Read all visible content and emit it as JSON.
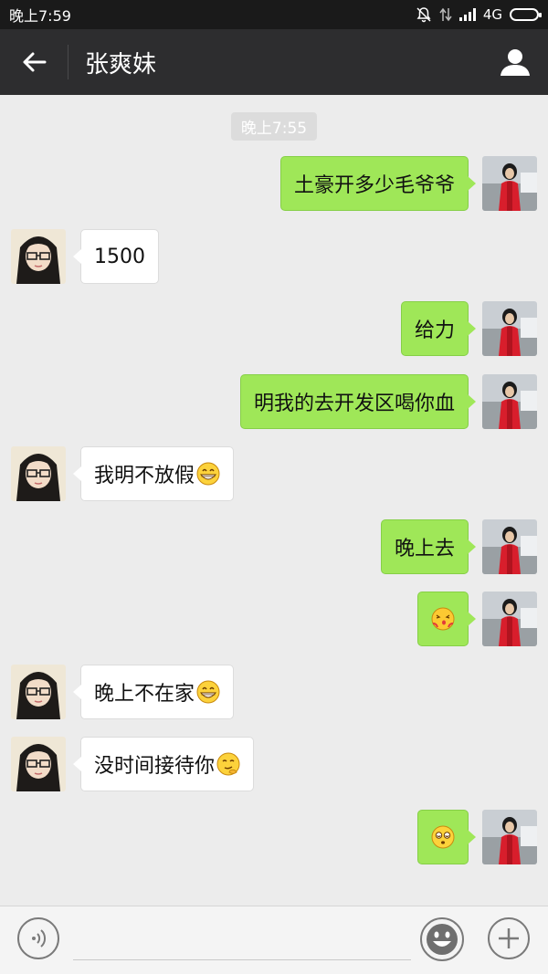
{
  "status_bar": {
    "time": "晚上7:59",
    "network": "4G"
  },
  "header": {
    "title": "张爽妹"
  },
  "chat": {
    "timestamp": "晚上7:55",
    "messages": [
      {
        "side": "right",
        "text": "土豪开多少毛爷爷",
        "emoji": ""
      },
      {
        "side": "left",
        "text": "1500",
        "emoji": ""
      },
      {
        "side": "right",
        "text": "给力",
        "emoji": ""
      },
      {
        "side": "right",
        "text": "明我的去开发区喝你血",
        "emoji": ""
      },
      {
        "side": "left",
        "text": "我明不放假",
        "emoji": "grin-emoji"
      },
      {
        "side": "right",
        "text": "晚上去",
        "emoji": ""
      },
      {
        "side": "right",
        "text": "",
        "emoji": "kiss-emoji"
      },
      {
        "side": "left",
        "text": "晚上不在家",
        "emoji": "grin-emoji"
      },
      {
        "side": "left",
        "text": "没时间接待你",
        "emoji": "smirk-emoji"
      },
      {
        "side": "right",
        "text": "",
        "emoji": "dizzy-emoji"
      }
    ]
  },
  "input_bar": {
    "placeholder": ""
  },
  "colors": {
    "header_bg": "#2d2d2f",
    "sent_bubble": "#9fe758",
    "received_bubble": "#ffffff",
    "chat_bg": "#ececec"
  }
}
